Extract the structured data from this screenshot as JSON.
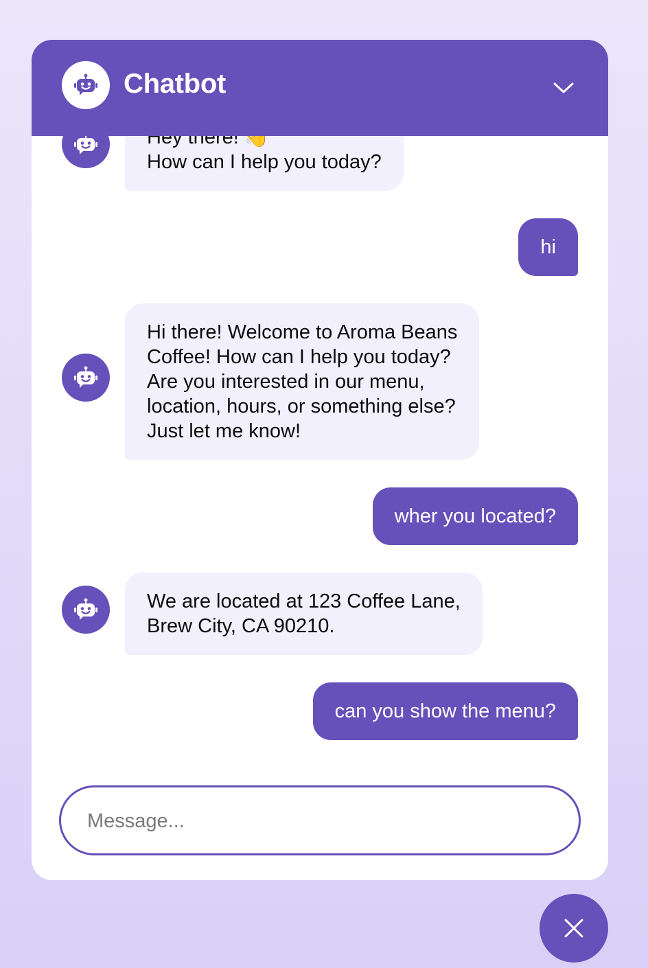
{
  "header": {
    "title": "Chatbot",
    "logo_icon": "robot-icon",
    "collapse_icon": "chevron-down-icon"
  },
  "messages": [
    {
      "role": "bot",
      "lines": [
        "Hey there! 👋",
        "How can I help you today?"
      ]
    },
    {
      "role": "user",
      "text": "hi"
    },
    {
      "role": "bot",
      "lines": [
        "Hi there! Welcome to Aroma Beans",
        "Coffee! How can I help you today?",
        "Are you interested in our menu,",
        "location, hours, or something else?",
        "Just let me know!"
      ]
    },
    {
      "role": "user",
      "text": "wher you located?"
    },
    {
      "role": "bot",
      "lines": [
        "We are located at 123 Coffee Lane,",
        "Brew City, CA 90210."
      ]
    },
    {
      "role": "user",
      "text": "can you show the menu?"
    }
  ],
  "composer": {
    "placeholder": "Message...",
    "value": ""
  },
  "launcher": {
    "icon": "close-icon"
  },
  "colors": {
    "primary": "#6650b9",
    "bot_bubble": "#f2f0fc",
    "background_top": "#ece6fb",
    "background_bottom": "#d9d0f7"
  }
}
